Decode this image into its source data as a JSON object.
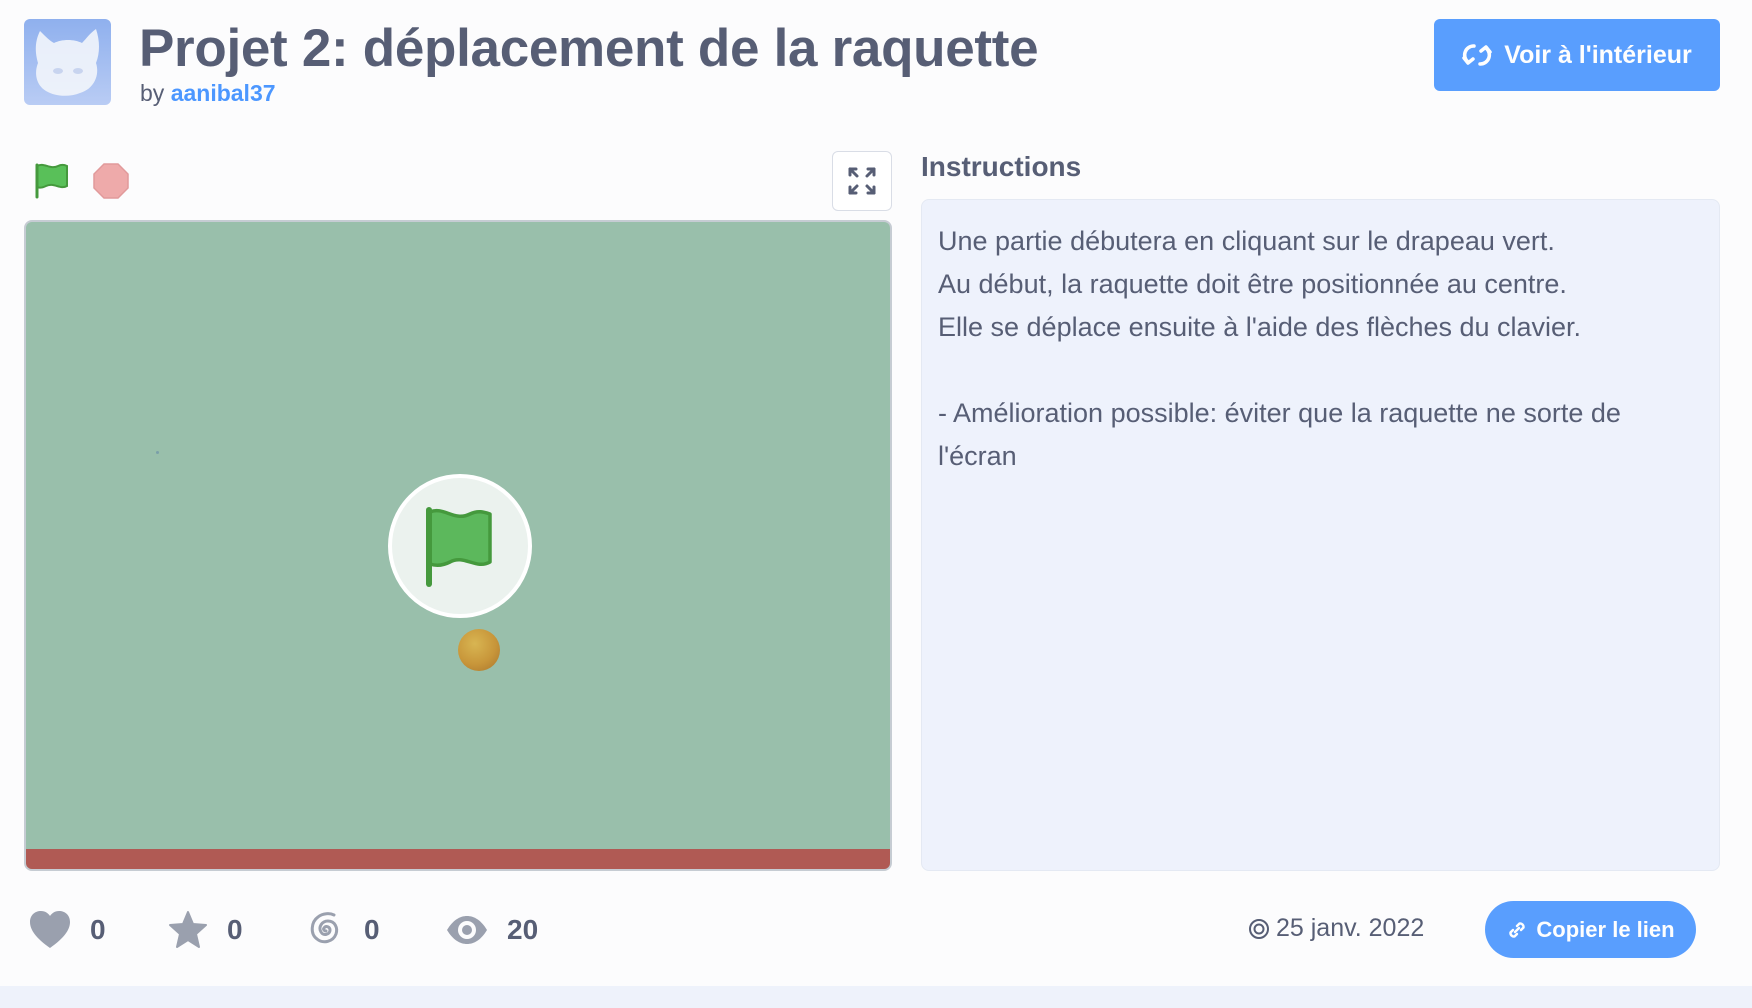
{
  "project": {
    "title": "Projet 2: déplacement de la raquette",
    "by_label": "by",
    "author": "aanibal37",
    "remix_label": "Voir à l'intérieur"
  },
  "player": {
    "fullscreen_icon": "fullscreen-icon",
    "stage_color": "#99bfab",
    "paddle_color": "#b05a54"
  },
  "instructions": {
    "heading": "Instructions",
    "lines": [
      "Une partie débutera en cliquant sur le drapeau vert.",
      "Au début, la raquette doit être positionnée au centre.",
      "Elle se déplace ensuite à l'aide des flèches du clavier.",
      "",
      "- Amélioration possible: éviter que la raquette ne sorte de",
      "l'écran"
    ]
  },
  "stats": {
    "loves": "0",
    "favorites": "0",
    "remixes": "0",
    "views": "20"
  },
  "date": "25 janv. 2022",
  "copy_link_label": "Copier le lien",
  "colors": {
    "accent": "#4c97ff",
    "text": "#575e75",
    "green_flag": "#5cb85c",
    "stop": "#ec9c9c"
  }
}
